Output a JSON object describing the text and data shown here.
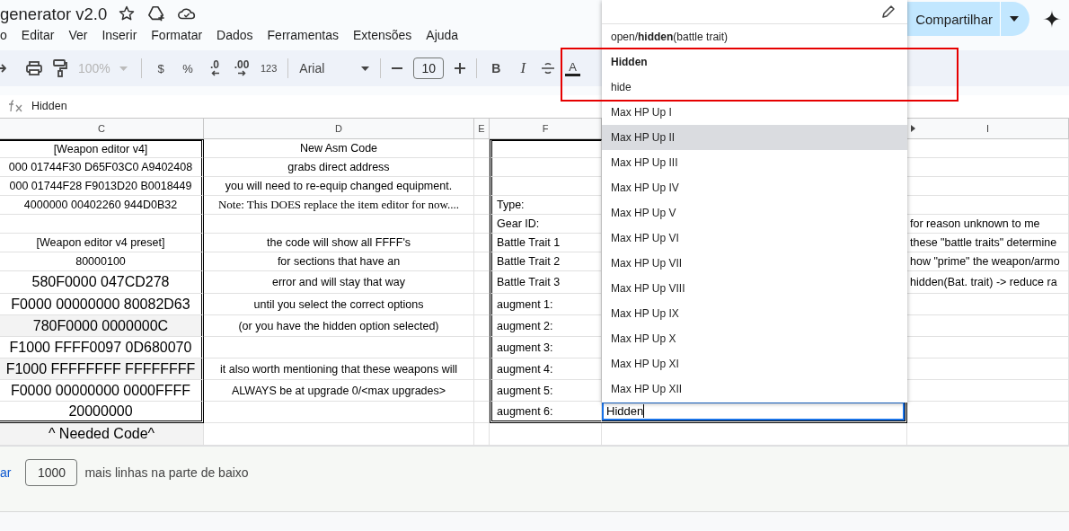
{
  "document": {
    "title": "generator v2.0"
  },
  "menu": [
    {
      "label": "o"
    },
    {
      "label": "Editar"
    },
    {
      "label": "Ver"
    },
    {
      "label": "Inserir"
    },
    {
      "label": "Formatar"
    },
    {
      "label": "Dados"
    },
    {
      "label": "Ferramentas"
    },
    {
      "label": "Extensões"
    },
    {
      "label": "Ajuda"
    }
  ],
  "toolbar": {
    "zoom": "100%",
    "currency": "$",
    "percent": "%",
    "decrease_decimals": ".0",
    "increase_decimals": ".00",
    "number_format": "123",
    "font": "Arial",
    "font_size": "10",
    "bold": "B",
    "italic": "I",
    "text_color": "A"
  },
  "share_button": "Compartilhar",
  "formula_bar": {
    "value": "Hidden"
  },
  "sheet": {
    "columns": [
      "C",
      "D",
      "E",
      "F",
      "I"
    ],
    "rows": [
      {
        "c": "[Weapon editor v4]",
        "d": "New Asm Code"
      },
      {
        "c": "000 01744F30 D65F03C0 A9402408",
        "d": "grabs direct address"
      },
      {
        "c": "000 01744F28 F9013D20 B0018449",
        "d": "you will need to re-equip changed equipment."
      },
      {
        "c": "4000000 00402260 944D0B32",
        "d": "Note: This DOES replace the item editor for now....",
        "f": "Type:"
      },
      {
        "f": "Gear ID:",
        "i": "for reason unknown to me"
      },
      {
        "c": "[Weapon editor v4 preset]",
        "d": "the code will show all FFFF's",
        "f": "Battle Trait 1",
        "i": "these \"battle traits\" determine"
      },
      {
        "c": "80000100",
        "d": "for sections that have an",
        "f": "Battle Trait 2",
        "i": "how \"prime\" the weapon/armo"
      },
      {
        "c": "580F0000 047CD278",
        "d": "error and will stay that way",
        "f": "Battle Trait 3",
        "i": "hidden(Bat. trait) -> reduce ra"
      },
      {
        "c": "F0000 00000000 80082D63",
        "d": "until you select the correct options",
        "f": "augment 1:"
      },
      {
        "c": "780F0000 0000000C",
        "d": "(or you have the hidden option selected)",
        "f": "augment 2:"
      },
      {
        "c": "F1000 FFFF0097 0D680070",
        "f": "augment 3:"
      },
      {
        "c": "F1000 FFFFFFFF FFFFFFFF",
        "d": "it also worth mentioning that these weapons will",
        "f": "augment 4:"
      },
      {
        "c": "F0000 00000000 0000FFFF",
        "d": "ALWAYS be at upgrade 0/<max upgrades>",
        "f": "augment 5:"
      },
      {
        "c": "20000000",
        "f": "augment 6:"
      },
      {
        "c": "^ Needed Code^"
      }
    ]
  },
  "dropdown": {
    "items": [
      {
        "label": "open/**hidden**(battle trait)",
        "selected": false,
        "emphasized": false
      },
      {
        "label": "Hidden",
        "selected": false,
        "emphasized": true
      },
      {
        "label": "hide",
        "selected": false,
        "emphasized": false
      },
      {
        "label": "Max HP Up I",
        "selected": false,
        "emphasized": false
      },
      {
        "label": "Max HP Up II",
        "selected": true,
        "emphasized": false
      },
      {
        "label": "Max HP Up III",
        "selected": false,
        "emphasized": false
      },
      {
        "label": "Max HP Up IV",
        "selected": false,
        "emphasized": false
      },
      {
        "label": "Max HP Up V",
        "selected": false,
        "emphasized": false
      },
      {
        "label": "Max HP Up VI",
        "selected": false,
        "emphasized": false
      },
      {
        "label": "Max HP Up VII",
        "selected": false,
        "emphasized": false
      },
      {
        "label": "Max HP Up VIII",
        "selected": false,
        "emphasized": false
      },
      {
        "label": "Max HP Up IX",
        "selected": false,
        "emphasized": false
      },
      {
        "label": "Max HP Up X",
        "selected": false,
        "emphasized": false
      },
      {
        "label": "Max HP Up XI",
        "selected": false,
        "emphasized": false
      },
      {
        "label": "Max HP Up XII",
        "selected": false,
        "emphasized": false
      }
    ]
  },
  "cell_editor": {
    "value": "Hidden"
  },
  "footer": {
    "link": "ar",
    "rows_value": "1000",
    "text": "mais linhas na parte de baixo"
  }
}
